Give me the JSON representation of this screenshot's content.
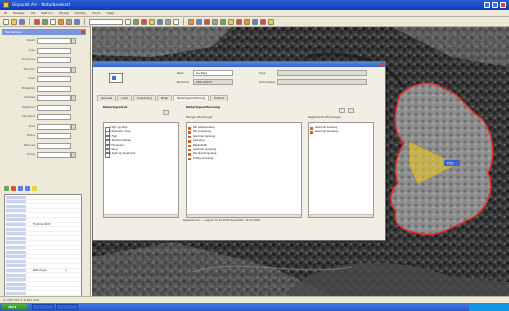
{
  "window": {
    "title": "Gispunkt Arc - Naturbasekart"
  },
  "menubar": {
    "items": [
      "Fil",
      "Rediger",
      "Vis",
      "Sett inn",
      "Utvalg",
      "Verktøy",
      "Vindu",
      "Hjelp"
    ]
  },
  "toolbar": {
    "button_colors": [
      "#f5f5f5",
      "#f2c94c",
      "#5b7fd6",
      "#d94c3d",
      "#6aa84f",
      "#f5f5f5",
      "#e69138",
      "#9e9e9e",
      "#5b7fd6",
      "#f5f5f5",
      "#6aa84f",
      "#d94c3d",
      "#f2c94c",
      "#5b7fd6",
      "#9e9e9e",
      "#f5f5f5",
      "#e69138",
      "#5b7fd6",
      "#d94c3d",
      "#9e9e9e",
      "#6aa84f",
      "#f2c94c",
      "#d94c3d",
      "#e69138",
      "#5b7fd6",
      "#d94c3d",
      "#f2c94c"
    ]
  },
  "left_panel": {
    "header": "Egenskaper",
    "properties": [
      "Objekt",
      "Type",
      "Kommune",
      "Eiendom",
      "Areal",
      "Målestokk",
      "Kartblad",
      "Registrert",
      "Oppdatert",
      "Kilde",
      "Status",
      "Merknad",
      "Utvalg"
    ],
    "layers": [
      {
        "name": "",
        "value": ""
      },
      {
        "name": "",
        "value": ""
      },
      {
        "name": "",
        "value": ""
      },
      {
        "name": "",
        "value": ""
      },
      {
        "name": "",
        "value": ""
      },
      {
        "name": "",
        "value": ""
      },
      {
        "name": "Flybilde 2005",
        "value": ""
      },
      {
        "name": "",
        "value": ""
      },
      {
        "name": "",
        "value": ""
      },
      {
        "name": "",
        "value": ""
      },
      {
        "name": "",
        "value": ""
      },
      {
        "name": "",
        "value": ""
      },
      {
        "name": "",
        "value": ""
      },
      {
        "name": "",
        "value": ""
      },
      {
        "name": "",
        "value": ""
      },
      {
        "name": "",
        "value": ""
      },
      {
        "name": "Naturtyper",
        "value": "+"
      },
      {
        "name": "",
        "value": ""
      },
      {
        "name": "",
        "value": ""
      },
      {
        "name": "",
        "value": ""
      },
      {
        "name": "",
        "value": ""
      },
      {
        "name": "",
        "value": ""
      },
      {
        "name": "Linjer",
        "value": ""
      },
      {
        "name": "Punkter",
        "value": "20"
      },
      {
        "name": "",
        "value": ""
      }
    ]
  },
  "dialog": {
    "name_label": "Navn",
    "name_value": "Lia-fløya",
    "number_label": "Nummer",
    "number_value": "0301-00123",
    "right_label_1": "Type",
    "right_label_2": "Kommentar",
    "tabs": [
      "Generelt",
      "Lokal",
      "Inventering",
      "Kilder",
      "Naturtyper/utforming",
      "Tilstand"
    ],
    "left_pane_title": "Naturtypenivå",
    "left_tree": [
      "A Myr og kilde",
      "B Rasmark, berg",
      "C Fjell",
      "D Kulturlandskap",
      "E Ferskvann",
      "F Skog",
      "G Kyst og havstrand"
    ],
    "middle_pane_title": "Naturtypeutforming",
    "middle_sub": "Mulige utforminger",
    "middle_list": [
      "Rik edellauvskog",
      "Rik sumpskog",
      "Gammel barskog",
      "Kalkskog",
      "Bekkekløft",
      "Gammel lauvskog",
      "Rik blandingsskog",
      "Fuktig lauvskog"
    ],
    "right_pane_title": "Registrerte utforminger",
    "right_list": [
      "Gammel barskog",
      "Gammel lauvskog"
    ],
    "footer_text": "Registrert av: ... Lagret: 12.04.2006 Oppdatert: 12.04.2006"
  },
  "map": {
    "polygon_color": "#e03030",
    "highlight_color": "#f0d020",
    "selection_label": "F05"
  },
  "statusbar": {
    "text": "X: 243 512 Y: 6 643 210"
  },
  "taskbar": {
    "start_label": "start"
  }
}
